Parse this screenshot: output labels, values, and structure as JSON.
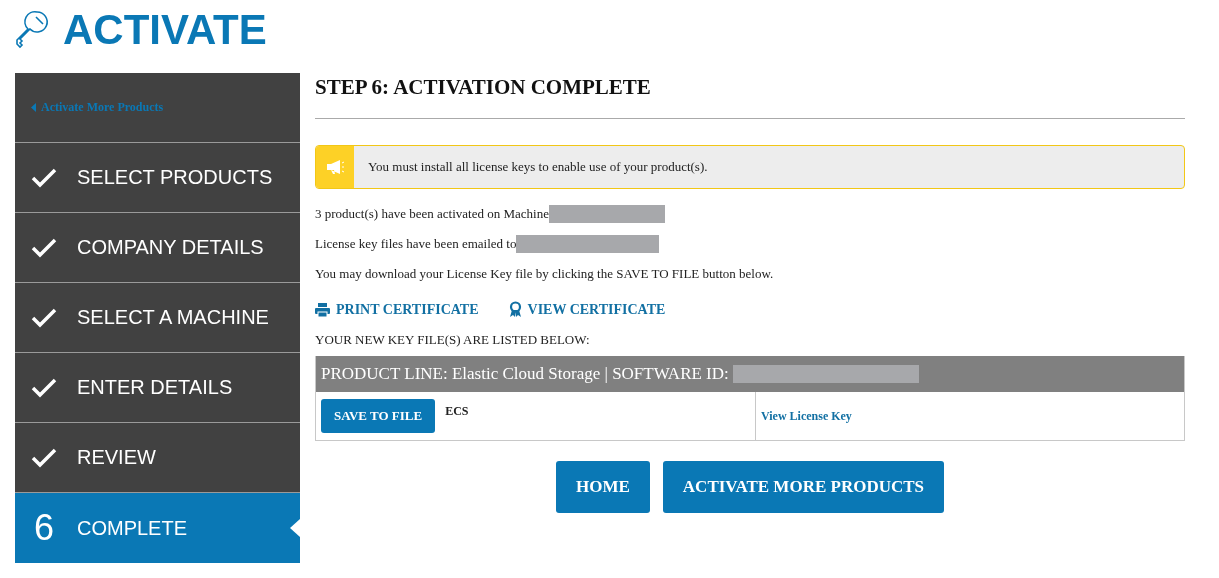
{
  "page_title": "ACTIVATE",
  "sidebar": {
    "back_link": "Activate More Products",
    "steps": [
      {
        "label": "SELECT PRODUCTS",
        "kind": "done",
        "selected": false
      },
      {
        "label": "COMPANY DETAILS",
        "kind": "done",
        "selected": false
      },
      {
        "label": "SELECT A MACHINE",
        "kind": "done",
        "selected": false
      },
      {
        "label": "ENTER DETAILS",
        "kind": "done",
        "selected": false
      },
      {
        "label": "REVIEW",
        "kind": "done",
        "selected": false
      },
      {
        "label": "COMPLETE",
        "kind": "current",
        "number": "6",
        "selected": true
      }
    ]
  },
  "main": {
    "heading": "STEP 6: ACTIVATION COMPLETE",
    "notice": "You must install all license keys to enable use of your product(s).",
    "messages": [
      "3 product(s) have been activated on Machine",
      "License key files have been emailed to",
      "You may download your License Key file by clicking the SAVE TO FILE button below."
    ],
    "certificate_links": [
      {
        "label": "PRINT CERTIFICATE",
        "kind": "print"
      },
      {
        "label": "VIEW CERTIFICATE",
        "kind": "view"
      }
    ],
    "key_files_caption": "YOUR NEW KEY FILE(S) ARE LISTED BELOW:",
    "key_table": {
      "header": "PRODUCT LINE: Elastic Cloud Storage | SOFTWARE ID:",
      "rows": [
        {
          "button": "SAVE TO FILE",
          "product": "ECS",
          "link": "View License Key"
        }
      ]
    },
    "buttons": [
      "HOME",
      "ACTIVATE MORE PRODUCTS"
    ]
  }
}
